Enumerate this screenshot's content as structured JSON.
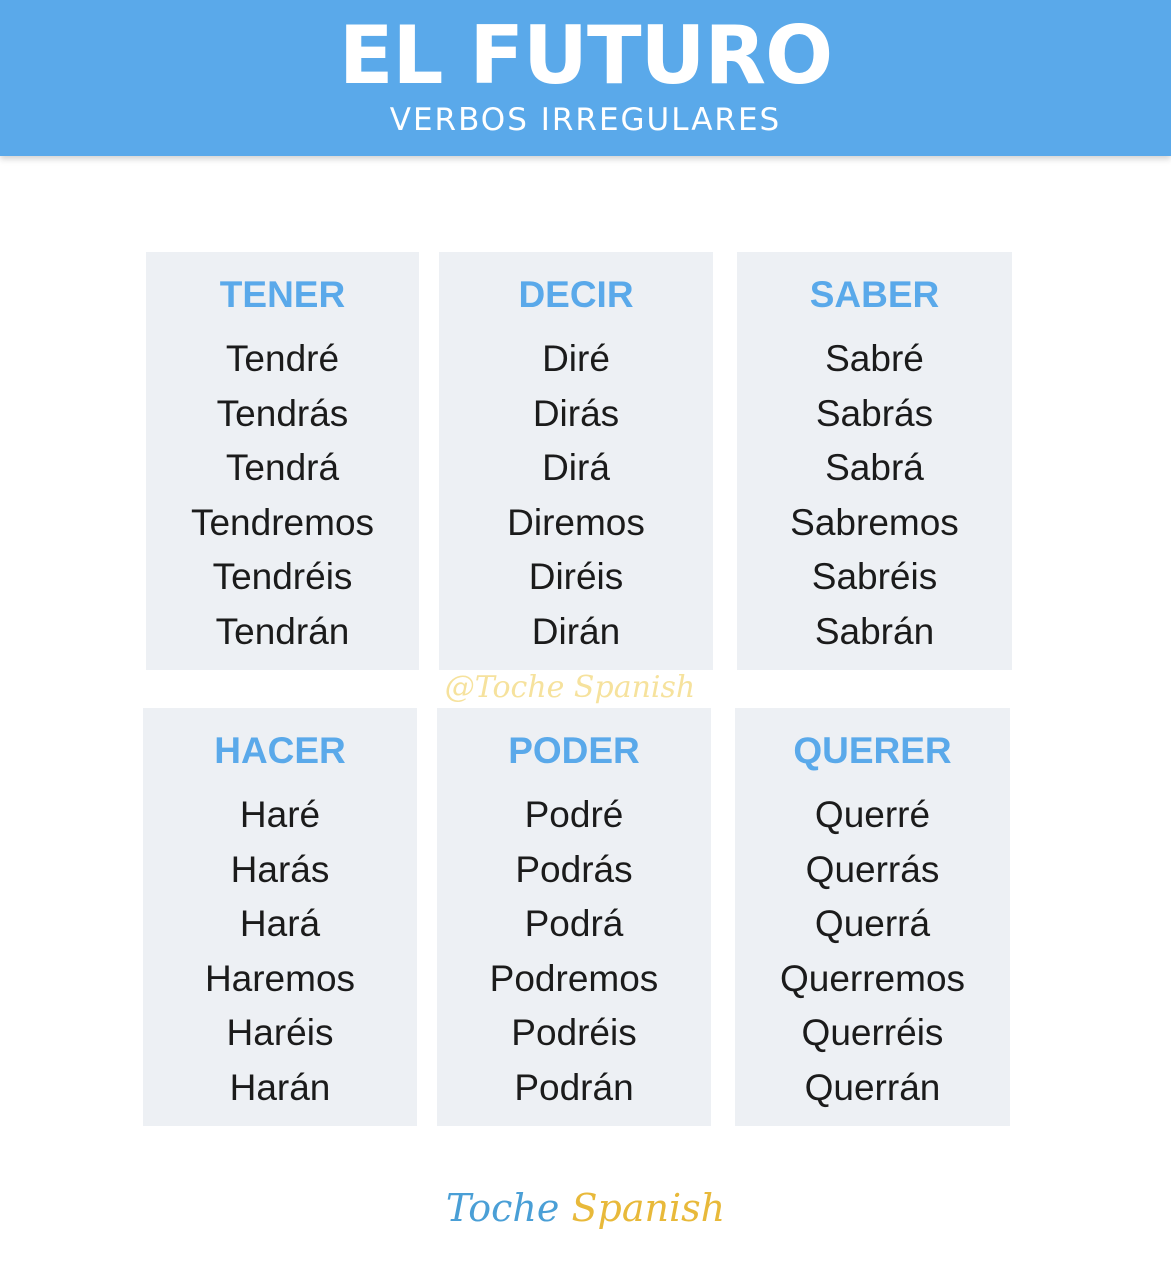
{
  "header": {
    "title": "EL FUTURO",
    "subtitle": "VERBOS IRREGULARES"
  },
  "verbs": [
    {
      "name": "TENER",
      "forms": [
        "Tendré",
        "Tendrás",
        "Tendrá",
        "Tendremos",
        "Tendréis",
        "Tendrán"
      ]
    },
    {
      "name": "DECIR",
      "forms": [
        "Diré",
        "Dirás",
        "Dirá",
        "Diremos",
        "Diréis",
        "Dirán"
      ]
    },
    {
      "name": "SABER",
      "forms": [
        "Sabré",
        "Sabrás",
        "Sabrá",
        "Sabremos",
        "Sabréis",
        "Sabrán"
      ]
    },
    {
      "name": "HACER",
      "forms": [
        "Haré",
        "Harás",
        "Hará",
        "Haremos",
        "Haréis",
        "Harán"
      ]
    },
    {
      "name": "PODER",
      "forms": [
        "Podré",
        "Podrás",
        "Podrá",
        "Podremos",
        "Podréis",
        "Podrán"
      ]
    },
    {
      "name": "QUERER",
      "forms": [
        "Querré",
        "Querrás",
        "Querrá",
        "Querremos",
        "Querréis",
        "Querrán"
      ]
    }
  ],
  "watermark": "@Toche Spanish",
  "footer": {
    "logo_word_1": "Toche",
    "logo_word_2": "Spanish"
  },
  "colors": {
    "header_background": "#5aa9ea",
    "verb_title": "#5aa9ea",
    "card_background": "#edf0f4",
    "logo_blue": "#4a9fd6",
    "logo_yellow": "#e8b93a"
  }
}
